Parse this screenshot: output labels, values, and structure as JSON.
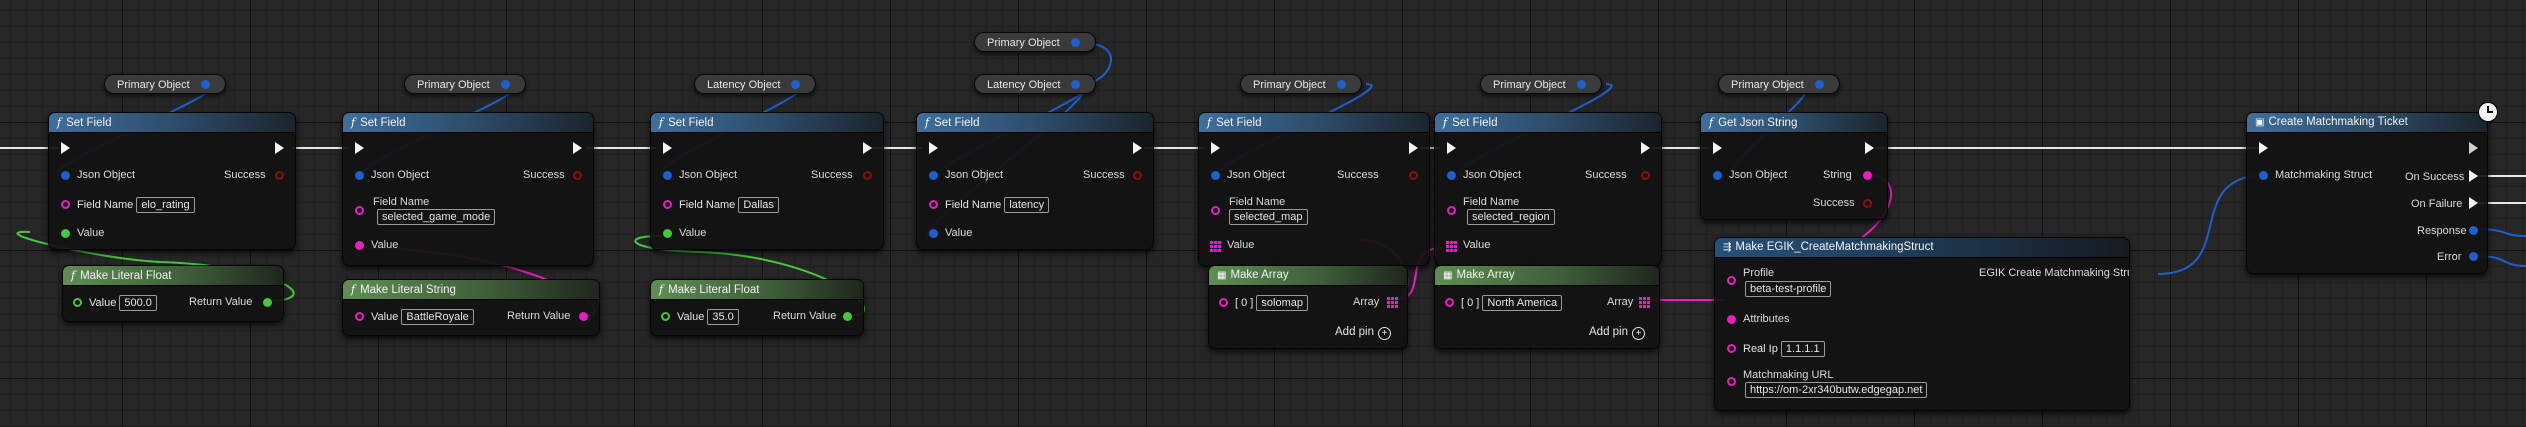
{
  "labels": {
    "set_field": "Set Field",
    "json_object": "Json Object",
    "success": "Success",
    "field_name": "Field Name",
    "value": "Value",
    "return_value": "Return Value",
    "make_literal_float": "Make Literal Float",
    "make_literal_string": "Make Literal String",
    "make_array": "Make Array",
    "array": "Array",
    "add_pin": "Add pin",
    "index0": "[ 0 ]",
    "get_json_string": "Get Json String",
    "string": "String",
    "primary_object": "Primary Object",
    "latency_object": "Latency Object",
    "plus": "+",
    "function_glyph": "f"
  },
  "set_fields": [
    {
      "field": "elo_rating"
    },
    {
      "field": "selected_game_mode"
    },
    {
      "field": "Dallas"
    },
    {
      "field": "latency"
    },
    {
      "field": "selected_map"
    },
    {
      "field": "selected_region"
    }
  ],
  "literals": {
    "float1": "500.0",
    "string1": "BattleRoyale",
    "float2": "35.0"
  },
  "arrays": [
    "solomap",
    "North America"
  ],
  "make_struct": {
    "title": "Make EGIK_CreateMatchmakingStruct",
    "profile_label": "Profile",
    "profile_value": "beta-test-profile",
    "attributes_label": "Attributes",
    "real_ip_label": "Real Ip",
    "real_ip_value": "1.1.1.1",
    "url_label": "Matchmaking URL",
    "url_value": "https://om-2xr340butw.edgegap.net",
    "output_label": "EGIK Create Matchmaking Struct"
  },
  "create_ticket": {
    "title": "Create Matchmaking Ticket",
    "input": "Matchmaking Struct",
    "on_success": "On Success",
    "on_failure": "On Failure",
    "response": "Response",
    "error": "Error"
  },
  "colors": {
    "object_pin": "#1e5fd0",
    "string_pin": "#e81ec0",
    "float_pin": "#46c83c",
    "bool_pin": "#8c0e0e",
    "exec": "#f2f2f2"
  },
  "icons": {
    "function": "function-icon",
    "array": "array-grid-icon",
    "clock": "latent-clock-icon",
    "struct": "make-struct-icon",
    "add": "add-pin-icon"
  }
}
